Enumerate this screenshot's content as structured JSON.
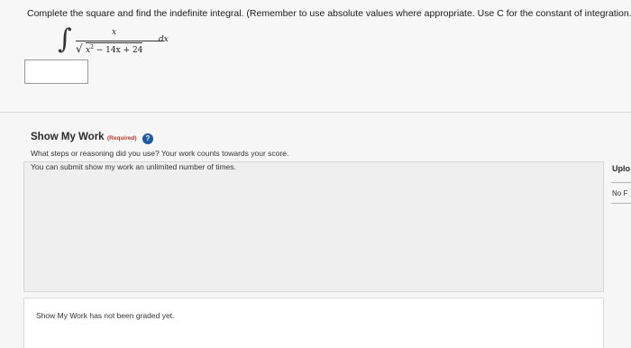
{
  "question": {
    "prompt": "Complete the square and find the indefinite integral. (Remember to use absolute values where appropriate. Use C for the constant of integration.)",
    "integral": {
      "sign": "∫",
      "numerator": "x",
      "radical": "√",
      "radicand_base": "x",
      "radicand_exponent": "2",
      "radicand_rest": " − 14x + 24",
      "differential": "dx"
    },
    "answer_value": ""
  },
  "show_my_work": {
    "title": "Show My Work",
    "required_label": "(Required)",
    "help_glyph": "?",
    "prompt": "What steps or reasoning did you use? Your work counts towards your score.",
    "note": "You can submit show my work an unlimited number of times.",
    "work_value": "",
    "grade_status": "Show My Work has not been graded yet."
  },
  "side_panel": {
    "upload_label": "Uplo",
    "file_status": "No F"
  },
  "icons": {
    "help": "question-mark-circle-icon"
  },
  "colors": {
    "help_icon": "#1f5aa6",
    "required_tag": "#c0392b"
  }
}
